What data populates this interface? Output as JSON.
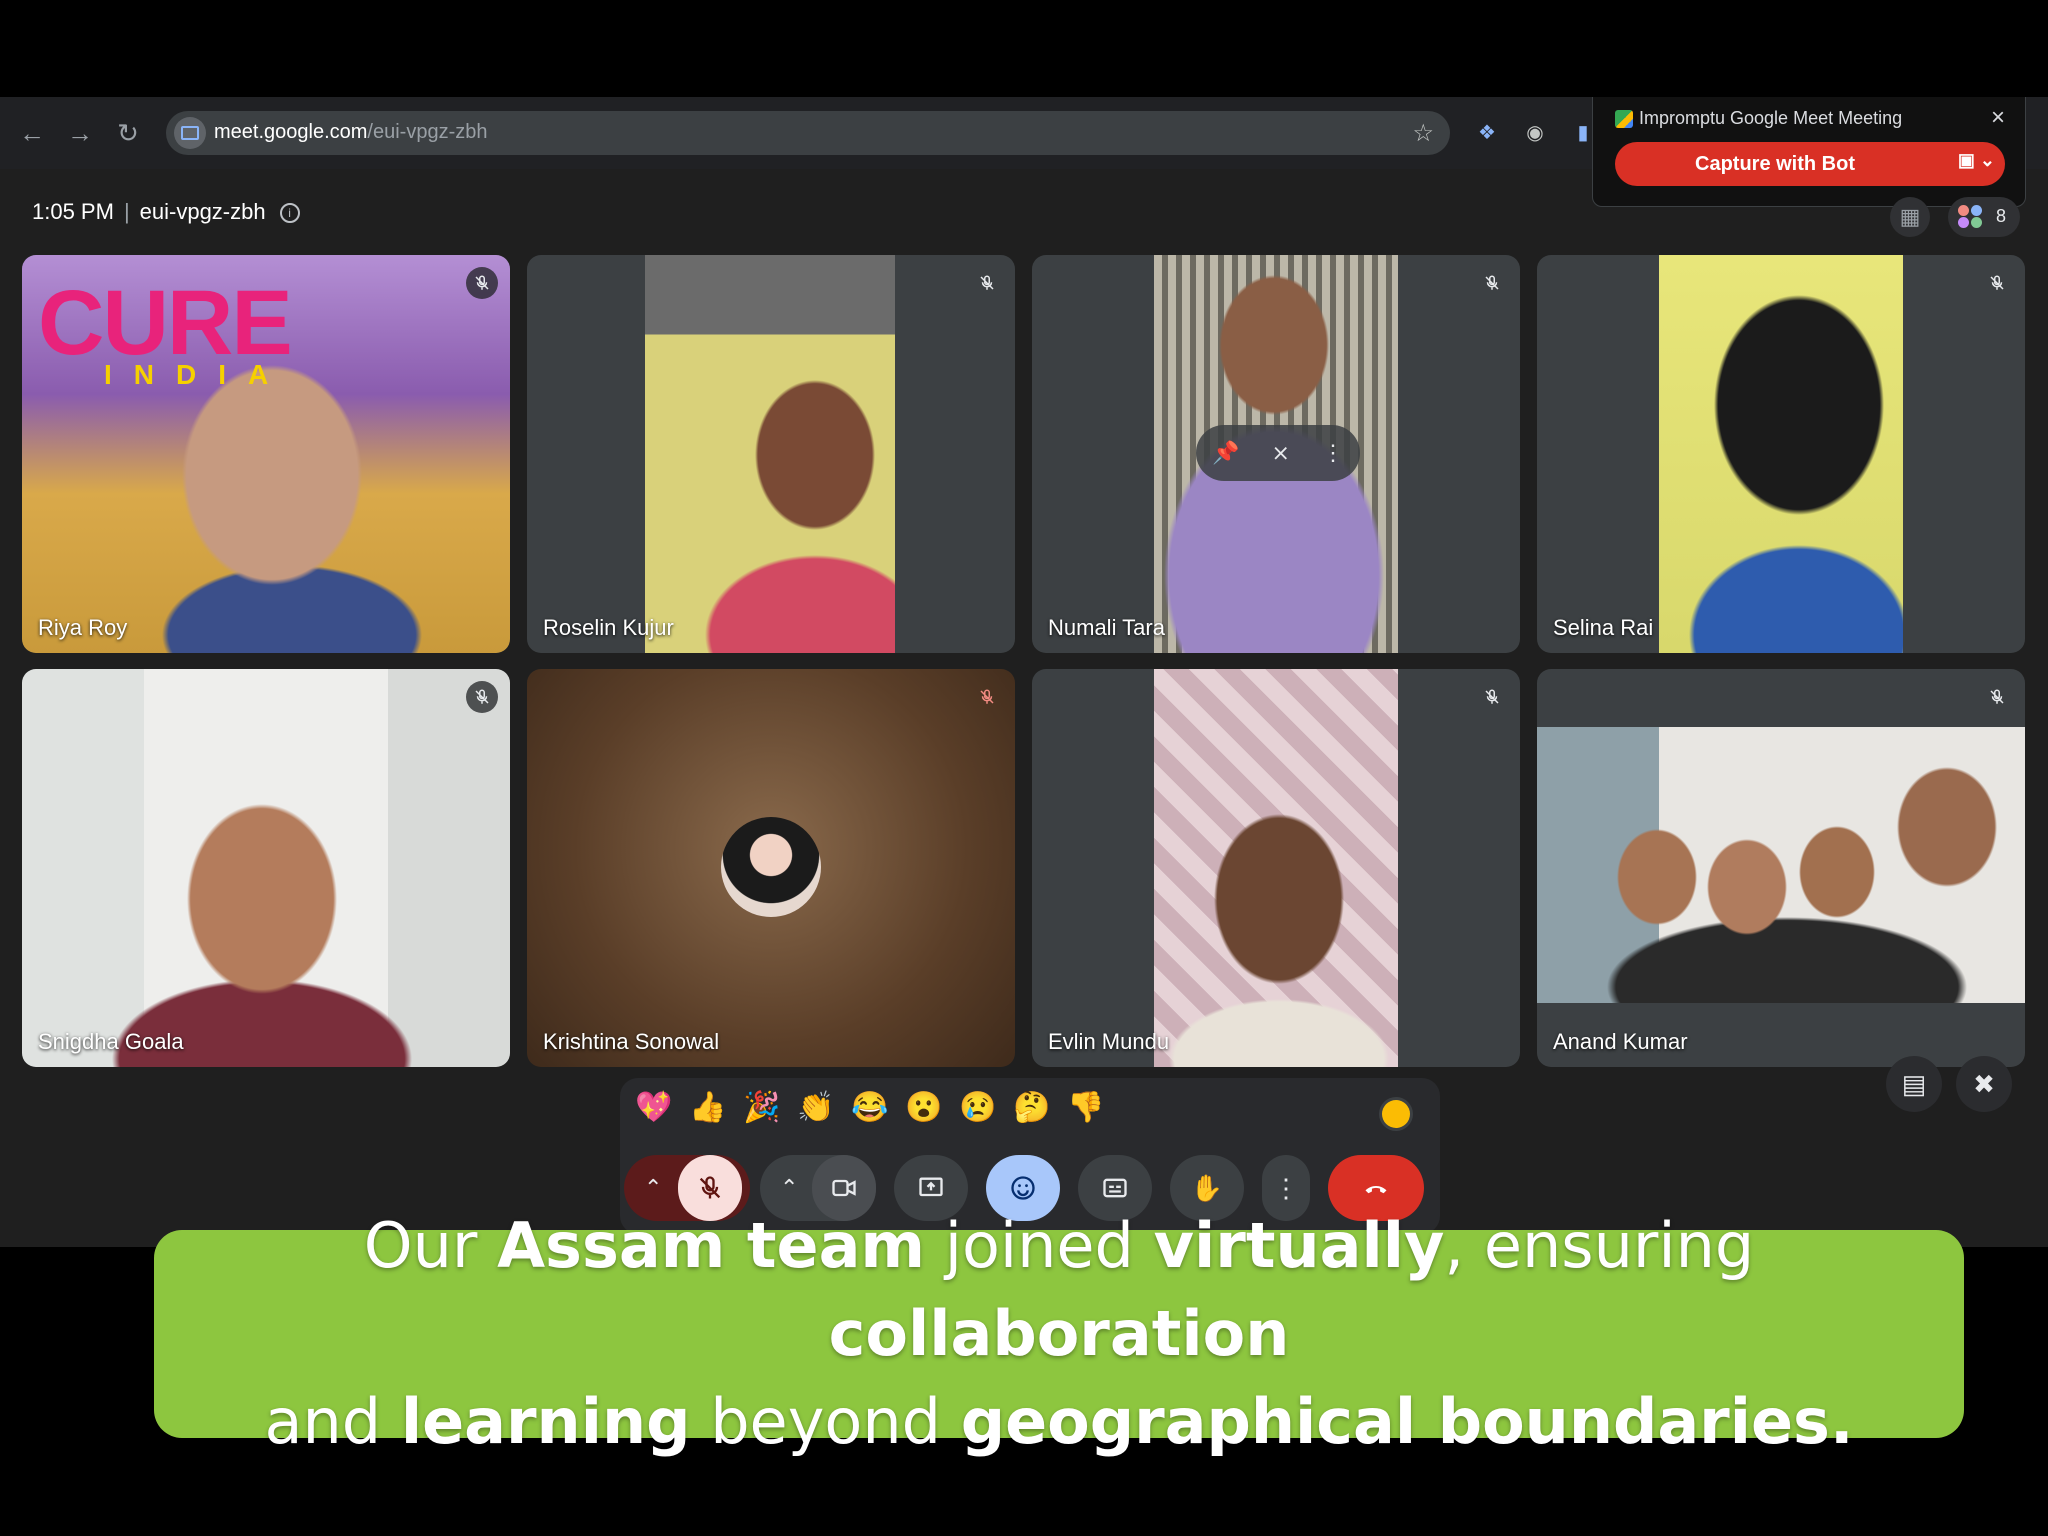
{
  "browser": {
    "url_host": "meet.google.com",
    "url_path": "/eui-vpgz-zbh"
  },
  "extension_popup": {
    "title": "Impromptu Google Meet Meeting",
    "button_label": "Capture with Bot"
  },
  "meeting": {
    "time": "1:05 PM",
    "code": "eui-vpgz-zbh",
    "participant_count": "8"
  },
  "logo": {
    "text": "CURE",
    "subtext": "INDIA"
  },
  "participants": [
    {
      "name": "Riya Roy"
    },
    {
      "name": "Roselin Kujur"
    },
    {
      "name": "Numali Tara"
    },
    {
      "name": "Selina Rai"
    },
    {
      "name": "Snigdha Goala"
    },
    {
      "name": "Krishtina Sonowal"
    },
    {
      "name": "Evlin Mundu"
    },
    {
      "name": "Anand Kumar"
    }
  ],
  "reactions": [
    "💖",
    "👍",
    "🎉",
    "👏",
    "😂",
    "😮",
    "😢",
    "🤔",
    "👎"
  ],
  "caption": {
    "p1": "Our ",
    "b1": "Assam team",
    "p2": " joined ",
    "b2": "virtually",
    "p3": ", ensuring ",
    "b3": "collaboration",
    "p4": "and ",
    "b4": "learning",
    "p5": " beyond ",
    "b5": "geographical boundaries."
  },
  "colors": {
    "end_call": "#d93025",
    "reaction_active": "#a8c7fa",
    "caption_bg": "#8dc63f",
    "mic_off_active": "#f9dedc"
  }
}
